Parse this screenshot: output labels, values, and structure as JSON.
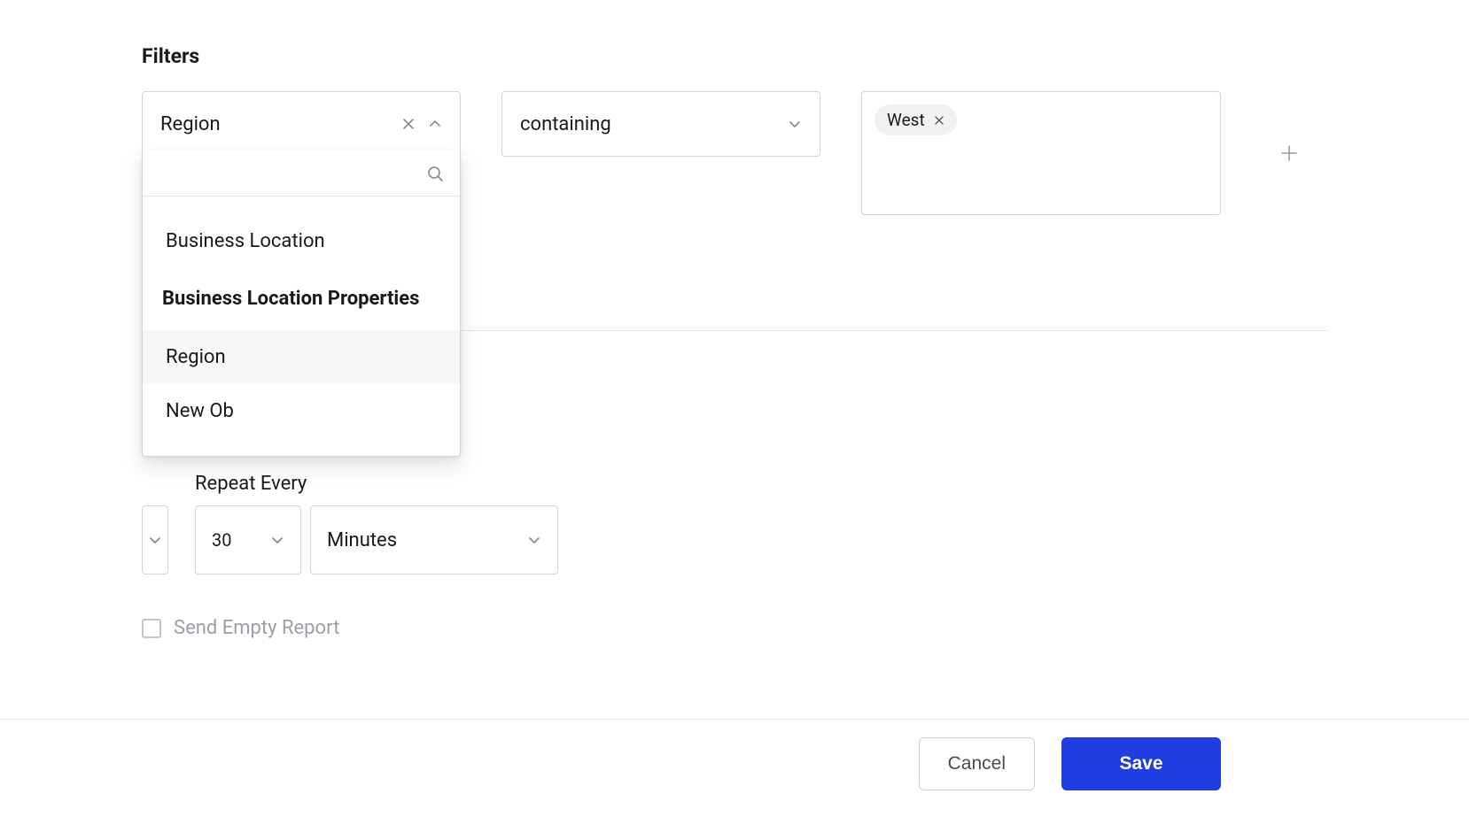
{
  "filters": {
    "title": "Filters",
    "field_value": "Region",
    "operator_value": "containing",
    "value_chip": "West",
    "dropdown": {
      "search_value": "",
      "search_placeholder": "",
      "option_business_location": "Business Location",
      "group_bl_props": "Business Location Properties",
      "option_region": "Region",
      "option_new_ob": "New Ob"
    }
  },
  "repeat": {
    "label": "Repeat Every",
    "interval_value": "30",
    "unit_value": "Minutes"
  },
  "send_empty_label": "Send Empty Report",
  "footer": {
    "cancel": "Cancel",
    "save": "Save"
  }
}
